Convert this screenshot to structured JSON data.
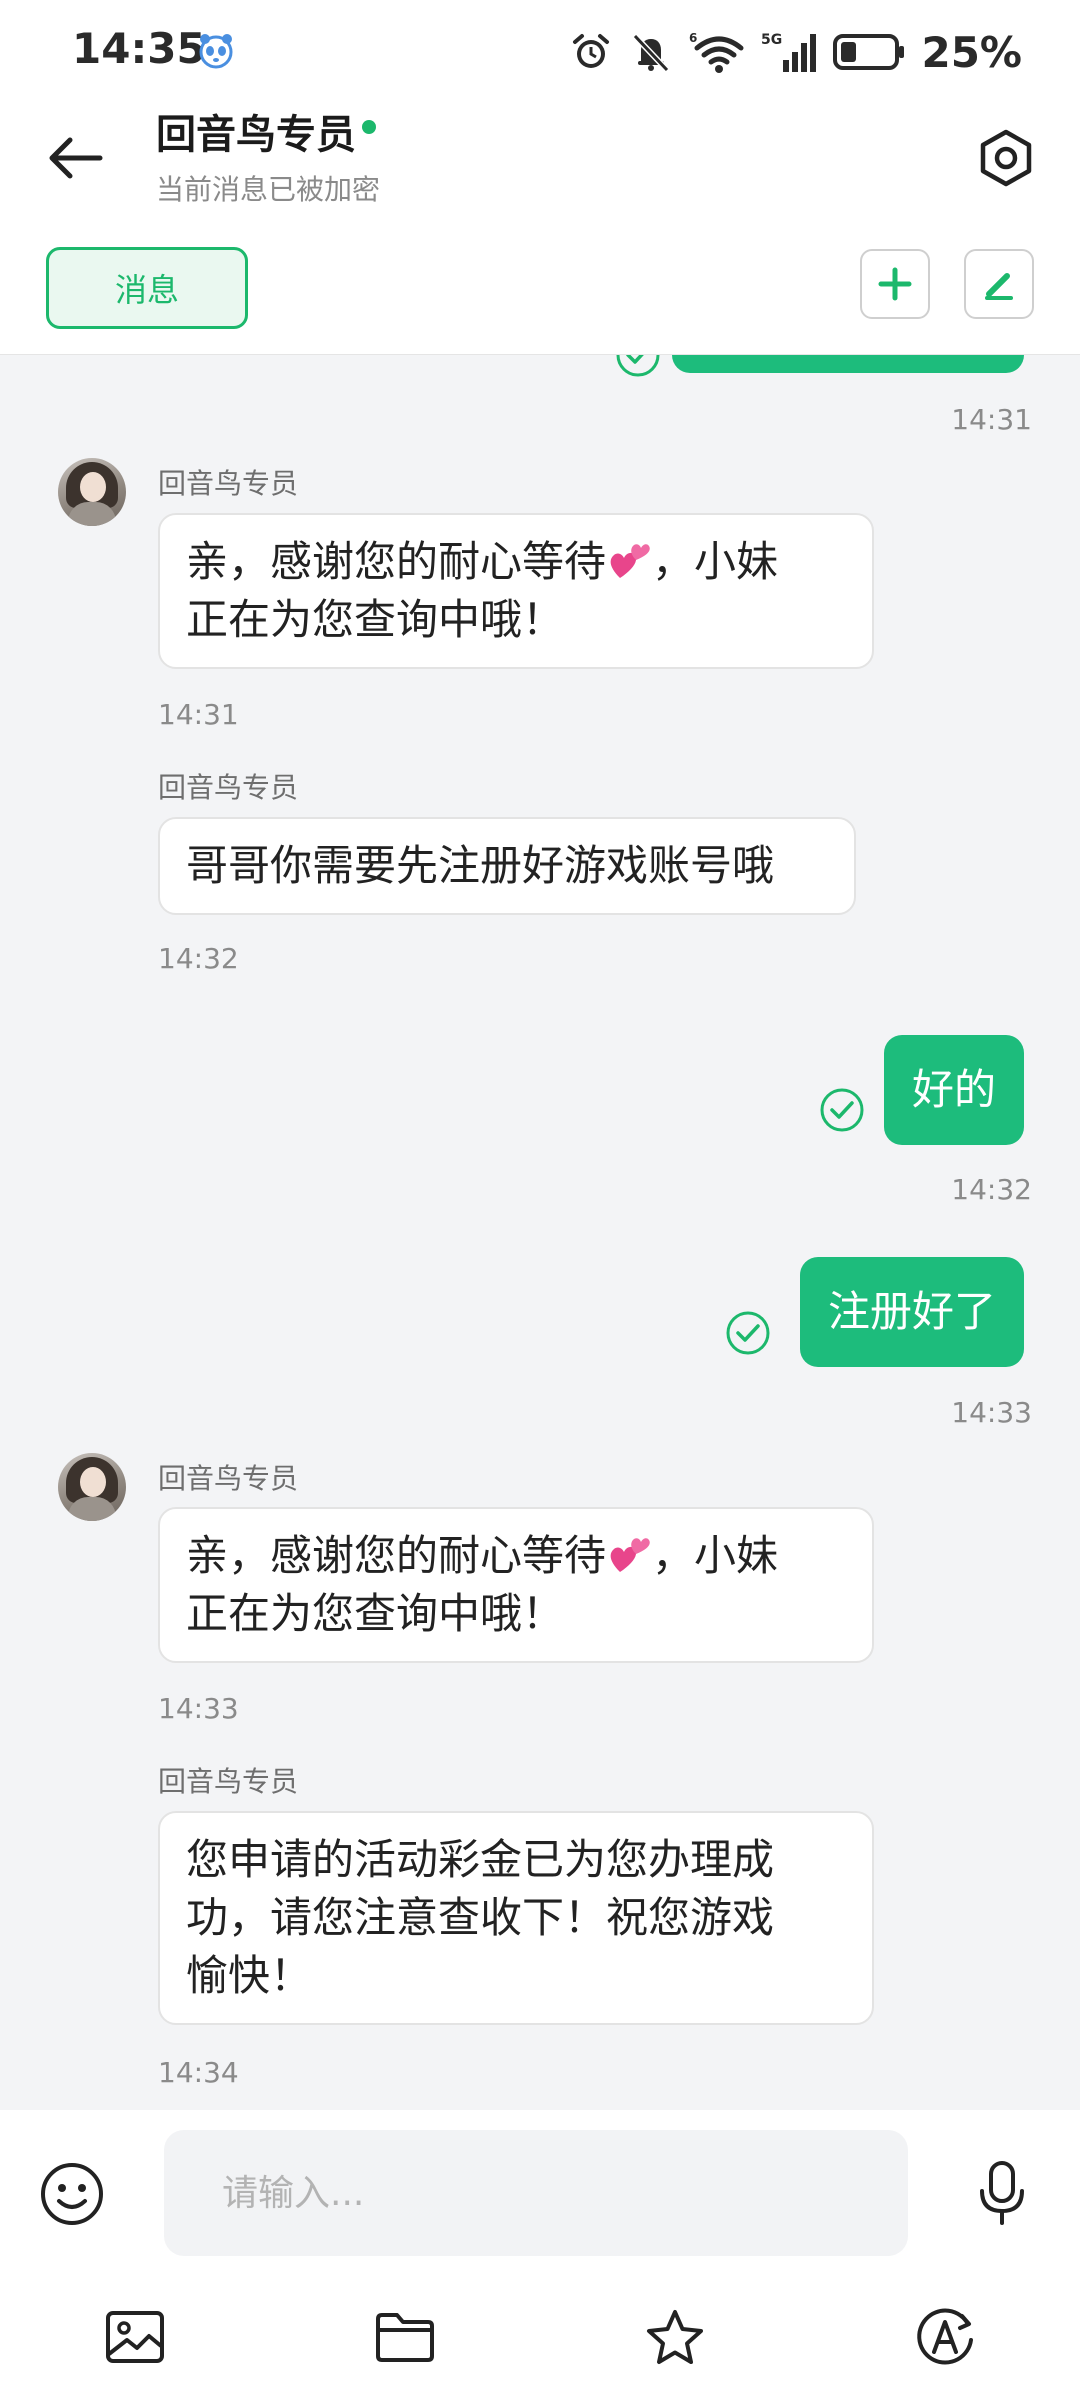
{
  "status_bar": {
    "time": "14:35",
    "battery_percent": "25%",
    "network_label": "5G",
    "wifi_label": "6"
  },
  "header": {
    "title": "回音鸟专员",
    "subtitle": "当前消息已被加密",
    "online": true
  },
  "tabs": {
    "message_label": "消息"
  },
  "messages": {
    "m0_time": "14:31",
    "m1": {
      "sender": "回音鸟专员",
      "line1_a": "亲，感谢您的耐心等待",
      "line1_b": "，小妹",
      "line2": "正在为您查询中哦！",
      "time": "14:31"
    },
    "m2": {
      "sender": "回音鸟专员",
      "text": "哥哥你需要先注册好游戏账号哦",
      "time": "14:32"
    },
    "m3": {
      "text": "好的",
      "time": "14:32"
    },
    "m4": {
      "text": "注册好了",
      "time": "14:33"
    },
    "m5": {
      "sender": "回音鸟专员",
      "line1_a": "亲，感谢您的耐心等待",
      "line1_b": "，小妹",
      "line2": "正在为您查询中哦！",
      "time": "14:33"
    },
    "m6": {
      "sender": "回音鸟专员",
      "line1": "您申请的活动彩金已为您办理成",
      "line2": "功，请您注意查收下！祝您游戏",
      "line3": "愉快！",
      "time": "14:34"
    }
  },
  "input": {
    "placeholder": "请输入..."
  },
  "icons": {
    "back": "back-arrow-icon",
    "settings": "settings-hexagon-icon",
    "add": "plus-icon",
    "edit": "pencil-icon",
    "emoji": "smiley-icon",
    "mic": "microphone-icon",
    "image": "image-icon",
    "folder": "folder-icon",
    "star": "star-icon",
    "translate": "translate-icon",
    "sent": "check-circle-icon",
    "heart": "two-hearts-icon"
  },
  "colors": {
    "accent": "#1cb86c",
    "outgoing_bubble": "#1dbc7c",
    "background": "#f3f4f6"
  }
}
